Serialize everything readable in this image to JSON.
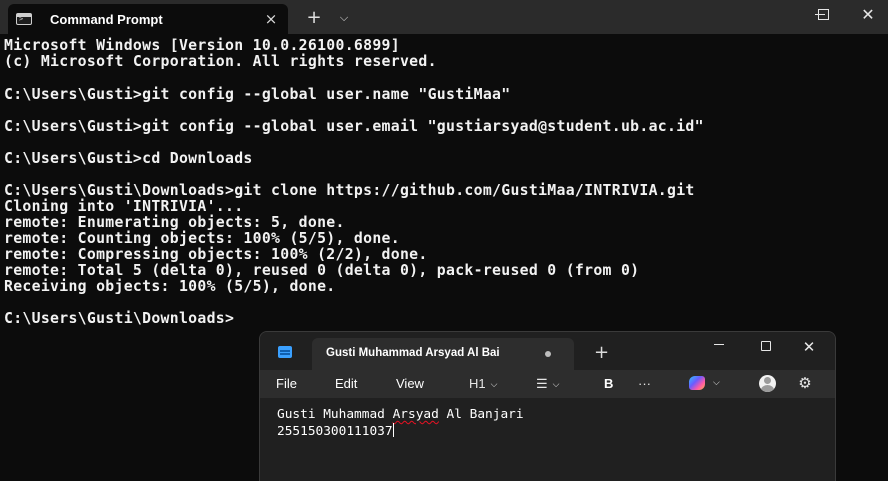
{
  "terminal": {
    "tab_title": "Command Prompt",
    "tab_close": "×",
    "new_tab": "+",
    "dropdown": "⌵",
    "window_controls": {
      "close": "✕"
    },
    "lines": [
      "Microsoft Windows [Version 10.0.26100.6899]",
      "(c) Microsoft Corporation. All rights reserved.",
      "",
      "C:\\Users\\Gusti>git config --global user.name \"GustiMaa\"",
      "",
      "C:\\Users\\Gusti>git config --global user.email \"gustiarsyad@student.ub.ac.id\"",
      "",
      "C:\\Users\\Gusti>cd Downloads",
      "",
      "C:\\Users\\Gusti\\Downloads>git clone https://github.com/GustiMaa/INTRIVIA.git",
      "Cloning into 'INTRIVIA'...",
      "remote: Enumerating objects: 5, done.",
      "remote: Counting objects: 100% (5/5), done.",
      "remote: Compressing objects: 100% (2/2), done.",
      "remote: Total 5 (delta 0), reused 0 (delta 0), pack-reused 0 (from 0)",
      "Receiving objects: 100% (5/5), done.",
      "",
      "C:\\Users\\Gusti\\Downloads>"
    ]
  },
  "notepad": {
    "tab_title": "Gusti Muhammad Arsyad Al Bai",
    "new_tab": "+",
    "window_controls": {
      "close": "✕"
    },
    "menu": {
      "file": "File",
      "edit": "Edit",
      "view": "View"
    },
    "toolbar": {
      "heading": "H1",
      "list": "☰",
      "bold": "B",
      "more": "···",
      "chevron": "⌵",
      "settings_glyph": "⚙"
    },
    "content": {
      "line1_pre": "Gusti Muhammad ",
      "line1_misspelled": "Arsyad",
      "line1_post": " Al Banjari",
      "line2": "255150300111037"
    }
  }
}
